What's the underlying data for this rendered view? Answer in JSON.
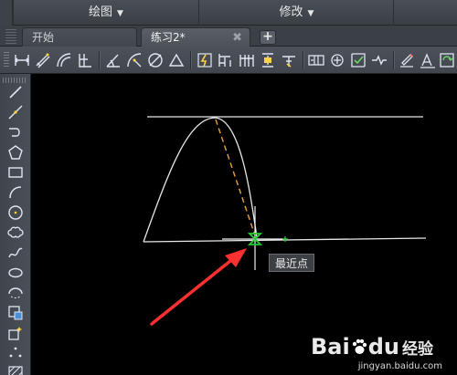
{
  "menubar": {
    "draw_label": "绘图",
    "modify_label": "修改"
  },
  "tabs": {
    "start_label": "开始",
    "document_label": "练习2*",
    "close_glyph": "✖",
    "new_tab_glyph": "+"
  },
  "toolbar_icons": [
    "dim-linear-icon",
    "dim-aligned-icon",
    "dim-arc-icon",
    "dim-ordinate-icon",
    "dim-angular-icon",
    "dim-radius-icon",
    "dim-diameter-icon",
    "dim-jogged-icon",
    "quick-dim-icon",
    "dim-baseline-icon",
    "dim-continue-icon",
    "dim-space-icon",
    "dim-break-icon",
    "tolerance-icon",
    "center-mark-icon",
    "inspect-icon",
    "jogged-linear-icon",
    "dim-edit-icon",
    "dim-text-edit-icon",
    "dim-update-icon"
  ],
  "draw_toolbar_icons": [
    "line-icon",
    "construction-line-icon",
    "polyline-icon",
    "polygon-icon",
    "rectangle-icon",
    "arc-icon",
    "circle-icon",
    "revision-cloud-icon",
    "spline-icon",
    "ellipse-icon",
    "ellipse-arc-icon",
    "insert-block-icon",
    "make-block-icon",
    "point-icon",
    "hatch-icon"
  ],
  "drawing": {
    "snap_tooltip": "最近点",
    "colors": {
      "geometry": "#e8e8e8",
      "tracking_dashed": "#e8a040",
      "snap_marker": "#22cc33",
      "annotation_arrow": "#ff3030"
    }
  },
  "watermark": {
    "brand": "Bai",
    "brand_suffix": "du",
    "brand_cn": "经验",
    "url": "jingyan.baidu.com"
  }
}
